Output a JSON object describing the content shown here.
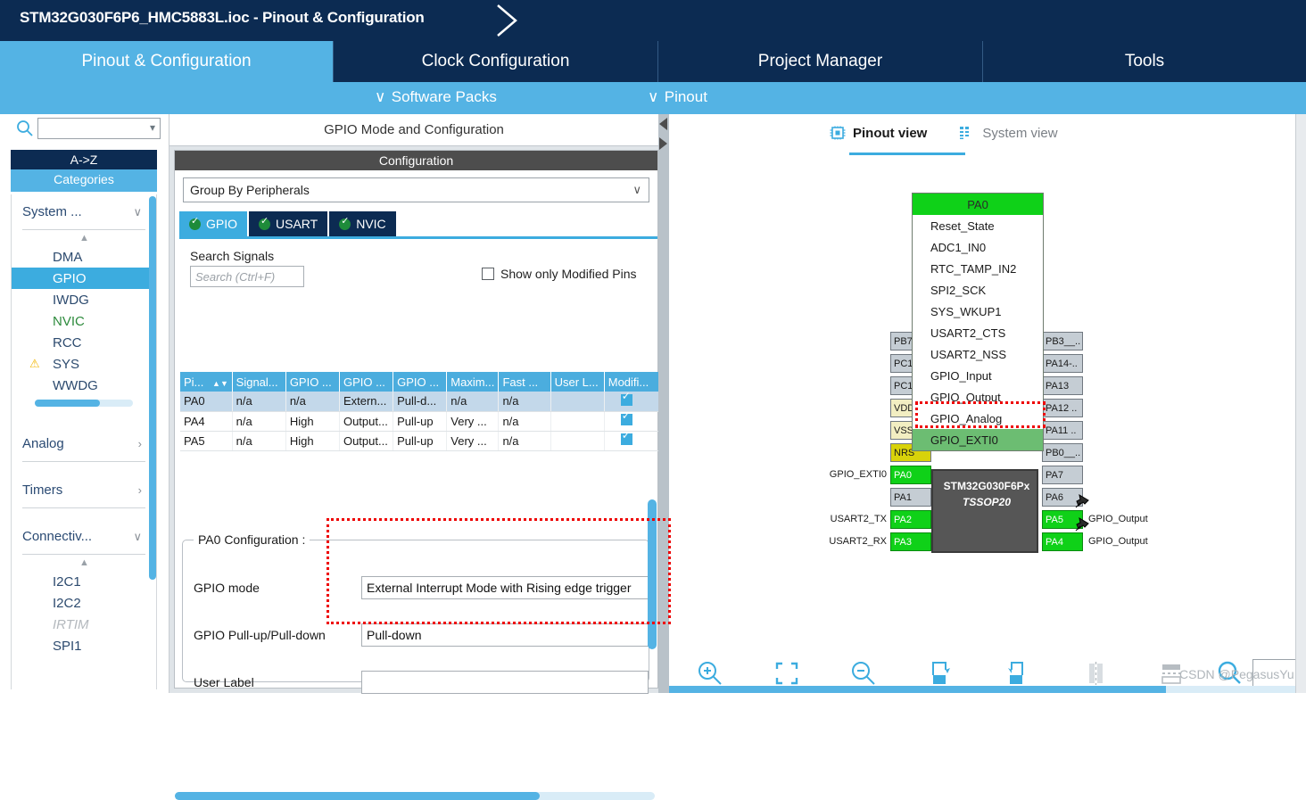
{
  "titlebar": {
    "title": "STM32G030F6P6_HMC5883L.ioc - Pinout & Configuration"
  },
  "main_tabs": [
    {
      "label": "Pinout & Configuration",
      "selected": true
    },
    {
      "label": "Clock Configuration",
      "selected": false
    },
    {
      "label": "Project Manager",
      "selected": false
    },
    {
      "label": "Tools",
      "selected": false
    }
  ],
  "subbar": {
    "software_packs": "Software Packs",
    "pinout": "Pinout",
    "chevron": "∨"
  },
  "sidebar": {
    "search_value": "",
    "search_icon": "search-icon",
    "tab_az": "A->Z",
    "tab_categories": "Categories",
    "categories": [
      {
        "name": "System ...",
        "arrow": "∨",
        "items": [
          {
            "label": "DMA",
            "state": "normal"
          },
          {
            "label": "GPIO",
            "state": "selected"
          },
          {
            "label": "IWDG",
            "state": "normal"
          },
          {
            "label": "NVIC",
            "state": "green"
          },
          {
            "label": "RCC",
            "state": "normal"
          },
          {
            "label": "SYS",
            "state": "warning"
          },
          {
            "label": "WWDG",
            "state": "normal"
          }
        ]
      },
      {
        "name": "Analog",
        "arrow": "›",
        "items": []
      },
      {
        "name": "Timers",
        "arrow": "›",
        "items": []
      },
      {
        "name": "Connectiv...",
        "arrow": "∨",
        "items": [
          {
            "label": "I2C1",
            "state": "normal"
          },
          {
            "label": "I2C2",
            "state": "normal"
          },
          {
            "label": "IRTIM",
            "state": "disabled"
          },
          {
            "label": "SPI1",
            "state": "normal"
          }
        ]
      }
    ]
  },
  "midpanel": {
    "header": "GPIO Mode and Configuration",
    "config_title": "Configuration",
    "group_by": "Group By Peripherals",
    "group_by_chevron": "∨",
    "peripheral_tabs": [
      {
        "label": "GPIO",
        "selected": true
      },
      {
        "label": "USART",
        "selected": false
      },
      {
        "label": "NVIC",
        "selected": false
      }
    ],
    "search_signals_label": "Search Signals",
    "search_signals_placeholder": "Search (Ctrl+F)",
    "search_signals_value": "",
    "show_modified_label": "Show only Modified Pins",
    "show_modified_checked": false,
    "table": {
      "columns": [
        "Pi...",
        "Signal...",
        "GPIO ...",
        "GPIO ...",
        "GPIO ...",
        "Maxim...",
        "Fast ...",
        "User L...",
        "Modifi..."
      ],
      "sort_column": 0,
      "rows": [
        {
          "selected": true,
          "cells": [
            "PA0",
            "n/a",
            "n/a",
            "Extern...",
            "Pull-d...",
            "n/a",
            "n/a",
            "",
            true
          ]
        },
        {
          "selected": false,
          "cells": [
            "PA4",
            "n/a",
            "High",
            "Output...",
            "Pull-up",
            "Very ...",
            "n/a",
            "",
            true
          ]
        },
        {
          "selected": false,
          "cells": [
            "PA5",
            "n/a",
            "High",
            "Output...",
            "Pull-up",
            "Very ...",
            "n/a",
            "",
            true
          ]
        }
      ]
    },
    "pa0_group_title": "PA0 Configuration :",
    "fields": [
      {
        "label": "GPIO mode",
        "value": "External Interrupt Mode with Rising edge trigger"
      },
      {
        "label": "GPIO Pull-up/Pull-down",
        "value": "Pull-down"
      },
      {
        "label": "User Label",
        "value": ""
      }
    ]
  },
  "rightpanel": {
    "view_tabs": [
      {
        "label": "Pinout view",
        "icon": "chip-icon",
        "selected": true
      },
      {
        "label": "System view",
        "icon": "grid-icon",
        "selected": false
      }
    ],
    "chip": {
      "name": "STM32G030F6Px",
      "package": "TSSOP20",
      "left_pins": [
        {
          "name": "PB7",
          "style": "grey",
          "label": ""
        },
        {
          "name": "PC1",
          "style": "grey",
          "label": ""
        },
        {
          "name": "PC1",
          "style": "grey",
          "label": ""
        },
        {
          "name": "VDD",
          "style": "yellowlt",
          "label": ""
        },
        {
          "name": "VSS",
          "style": "yellowlt",
          "label": ""
        },
        {
          "name": "NRS",
          "style": "yellow",
          "label": ""
        },
        {
          "name": "PA0",
          "style": "green",
          "label": "GPIO_EXTI0"
        },
        {
          "name": "PA1",
          "style": "grey",
          "label": ""
        },
        {
          "name": "PA2",
          "style": "green",
          "label": "USART2_TX"
        },
        {
          "name": "PA3",
          "style": "green",
          "label": "USART2_RX"
        }
      ],
      "right_pins": [
        {
          "name": "PB3__..",
          "style": "grey",
          "label": ""
        },
        {
          "name": "PA14-..",
          "style": "grey",
          "label": ""
        },
        {
          "name": "PA13",
          "style": "grey",
          "label": ""
        },
        {
          "name": "PA12 ..",
          "style": "grey",
          "label": ""
        },
        {
          "name": "PA11 ..",
          "style": "grey",
          "label": ""
        },
        {
          "name": "PB0__..",
          "style": "grey",
          "label": ""
        },
        {
          "name": "PA7",
          "style": "grey",
          "label": ""
        },
        {
          "name": "PA6",
          "style": "grey",
          "label": ""
        },
        {
          "name": "PA5",
          "style": "green",
          "label": "GPIO_Output"
        },
        {
          "name": "PA4",
          "style": "green",
          "label": "GPIO_Output"
        }
      ]
    },
    "pa0_menu": {
      "header": "PA0",
      "items": [
        {
          "label": "Reset_State",
          "highlighted": false
        },
        {
          "label": "ADC1_IN0",
          "highlighted": false
        },
        {
          "label": "RTC_TAMP_IN2",
          "highlighted": false
        },
        {
          "label": "SPI2_SCK",
          "highlighted": false
        },
        {
          "label": "SYS_WKUP1",
          "highlighted": false
        },
        {
          "label": "USART2_CTS",
          "highlighted": false
        },
        {
          "label": "USART2_NSS",
          "highlighted": false
        },
        {
          "label": "GPIO_Input",
          "highlighted": false
        },
        {
          "label": "GPIO_Output",
          "highlighted": false
        },
        {
          "label": "GPIO_Analog",
          "highlighted": false
        },
        {
          "label": "GPIO_EXTI0",
          "highlighted": true
        }
      ]
    },
    "toolbar_icons": [
      "zoom-in-icon",
      "fit-screen-icon",
      "zoom-out-icon",
      "rotate-right-icon",
      "rotate-left-icon",
      "flip-icon",
      "keepout-icon",
      "search-pin-icon"
    ],
    "toolbar_search_value": ""
  },
  "watermark": "CSDN @PegasusYu",
  "colors": {
    "brand_dark": "#0c2b52",
    "brand_light": "#54b3e4",
    "accent": "#3cacdf",
    "pin_green": "#0fd118",
    "highlight_red": "#ee0000"
  }
}
